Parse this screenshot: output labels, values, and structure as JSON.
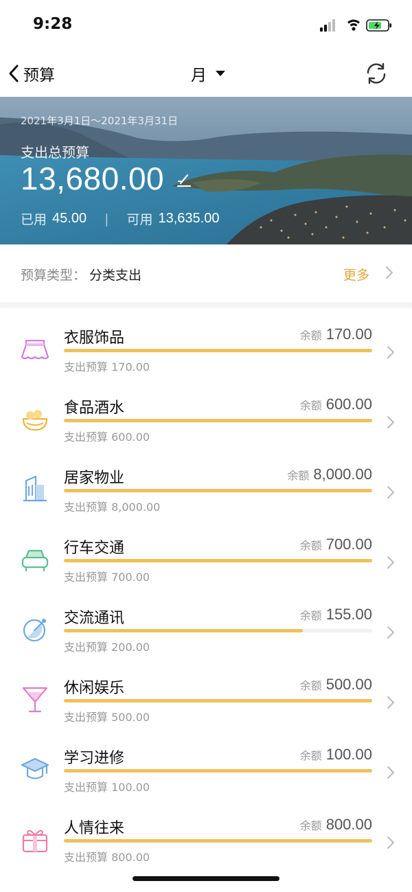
{
  "status_bar": {
    "time": "9:28"
  },
  "nav": {
    "back_label": "预算",
    "period_label": "月"
  },
  "hero": {
    "date_range": "2021年3月1日～2021年3月31日",
    "total_label": "支出总预算",
    "total_value": "13,680.00",
    "used_label": "已用",
    "used_value": "45.00",
    "separator": "|",
    "available_label": "可用",
    "available_value": "13,635.00"
  },
  "budget_type": {
    "label": "预算类型：",
    "value": "分类支出",
    "more_label": "更多"
  },
  "categories": [
    {
      "name": "衣服饰品",
      "remain_label": "余额",
      "remain": "170.00",
      "sub": "支出预算 170.00",
      "progress": 1.0,
      "icon": "clothing-icon",
      "color": "#D17BE0"
    },
    {
      "name": "食品酒水",
      "remain_label": "余额",
      "remain": "600.00",
      "sub": "支出预算 600.00",
      "progress": 1.0,
      "icon": "food-bowl-icon",
      "color": "#F2B33A"
    },
    {
      "name": "居家物业",
      "remain_label": "余额",
      "remain": "8,000.00",
      "sub": "支出预算 8,000.00",
      "progress": 1.0,
      "icon": "building-icon",
      "color": "#6FA8E0"
    },
    {
      "name": "行车交通",
      "remain_label": "余额",
      "remain": "700.00",
      "sub": "支出预算 700.00",
      "progress": 1.0,
      "icon": "car-icon",
      "color": "#5CC08F"
    },
    {
      "name": "交流通讯",
      "remain_label": "余额",
      "remain": "155.00",
      "sub": "支出预算 200.00",
      "progress": 0.775,
      "icon": "satellite-icon",
      "color": "#6FA8E0"
    },
    {
      "name": "休闲娱乐",
      "remain_label": "余额",
      "remain": "500.00",
      "sub": "支出预算 500.00",
      "progress": 1.0,
      "icon": "cocktail-icon",
      "color": "#E07BC8"
    },
    {
      "name": "学习进修",
      "remain_label": "余额",
      "remain": "100.00",
      "sub": "支出预算 100.00",
      "progress": 1.0,
      "icon": "graduation-cap-icon",
      "color": "#6FA8E0"
    },
    {
      "name": "人情往来",
      "remain_label": "余额",
      "remain": "800.00",
      "sub": "支出预算 800.00",
      "progress": 1.0,
      "icon": "gift-icon",
      "color": "#F07AA8"
    }
  ]
}
